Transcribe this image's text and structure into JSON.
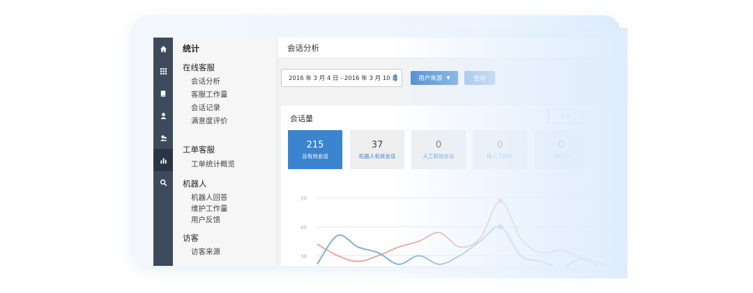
{
  "nav_rail": {
    "icons": [
      "home-icon",
      "apps-icon",
      "book-icon",
      "user-icon",
      "users-icon",
      "chart-icon",
      "search-icon"
    ],
    "active": "chart-icon"
  },
  "menu": {
    "title": "统计",
    "groups": [
      {
        "label": "在线客服",
        "items": [
          "会话分析",
          "客服工作量",
          "会话记录",
          "满意度评价"
        ]
      },
      {
        "label": "工单客服",
        "items": [
          "工单统计概览"
        ]
      },
      {
        "label": "机器人",
        "items": [
          "机器人回答",
          "维护工作量",
          "用户反馈"
        ]
      },
      {
        "label": "访客",
        "items": [
          "访客来源"
        ]
      }
    ]
  },
  "page": {
    "title": "会话分析",
    "date_range": "2016 年 3 月 4 日 - 2016 年 3 月 10 日",
    "source_button": "用户来源",
    "query_button": "查询"
  },
  "panel": {
    "title": "会话量",
    "export_label": "导出",
    "stats": [
      {
        "value": "215",
        "label": "总有效会话"
      },
      {
        "value": "37",
        "label": "机器人有效会话"
      },
      {
        "value": "0",
        "label": "人工有效会话"
      },
      {
        "value": "0",
        "label": "接人工排队"
      },
      {
        "value": "0",
        "label": "排队中"
      }
    ]
  },
  "colors": {
    "primary": "#3b84d0",
    "rail_bg": "#3c4a5c",
    "series_red": "#e8a79c",
    "series_blue": "#7fb0d8"
  },
  "chart_data": {
    "type": "line",
    "y_ticks": [
      "50",
      "40",
      "30"
    ],
    "ylim": [
      25,
      55
    ],
    "grid": true,
    "x": [
      0,
      1,
      2,
      3,
      4,
      5,
      6,
      7,
      8,
      9,
      10,
      11,
      12,
      13,
      14,
      15
    ],
    "series": [
      {
        "values": [
          34,
          30,
          28,
          30,
          33,
          35,
          38,
          33,
          36,
          49,
          36,
          31,
          32,
          29,
          26,
          25
        ],
        "color": "#e8a79c",
        "highlight_index": 9
      },
      {
        "values": [
          27,
          37,
          33,
          31,
          27,
          30,
          27,
          30,
          35,
          40,
          30,
          28,
          26,
          29,
          27,
          26
        ],
        "color": "#7fb0d8",
        "highlight_index": 9
      }
    ]
  }
}
